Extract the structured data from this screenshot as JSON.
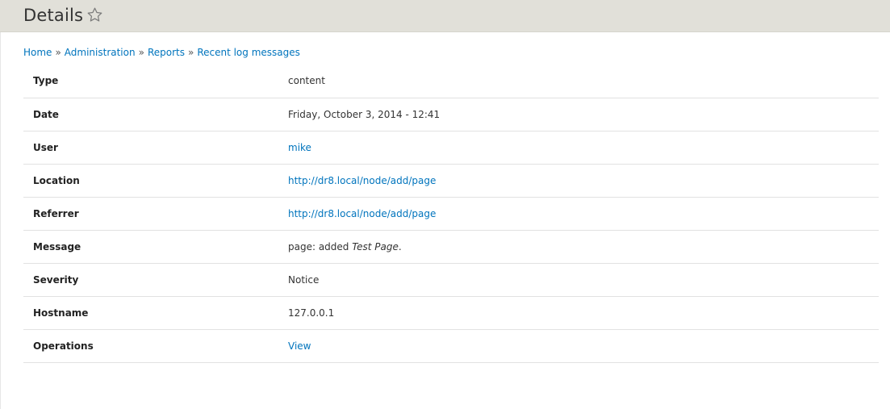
{
  "header": {
    "title": "Details"
  },
  "breadcrumb": {
    "items": [
      "Home",
      "Administration",
      "Reports",
      "Recent log messages"
    ],
    "separator": "»"
  },
  "details": {
    "type": {
      "label": "Type",
      "value": "content"
    },
    "date": {
      "label": "Date",
      "value": "Friday, October 3, 2014 - 12:41"
    },
    "user": {
      "label": "User",
      "value": "mike"
    },
    "location": {
      "label": "Location",
      "value": "http://dr8.local/node/add/page"
    },
    "referrer": {
      "label": "Referrer",
      "value": "http://dr8.local/node/add/page"
    },
    "message": {
      "label": "Message",
      "value_prefix": "page: added ",
      "value_emphasis": "Test Page",
      "value_suffix": "."
    },
    "severity": {
      "label": "Severity",
      "value": "Notice"
    },
    "hostname": {
      "label": "Hostname",
      "value": "127.0.0.1"
    },
    "operations": {
      "label": "Operations",
      "value": "View"
    }
  },
  "colors": {
    "header_bg": "#e1e0d9",
    "link": "#0074bd",
    "text": "#333333",
    "row_border": "#e2e2e2"
  },
  "icons": {
    "favorite": "star-outline-icon"
  }
}
